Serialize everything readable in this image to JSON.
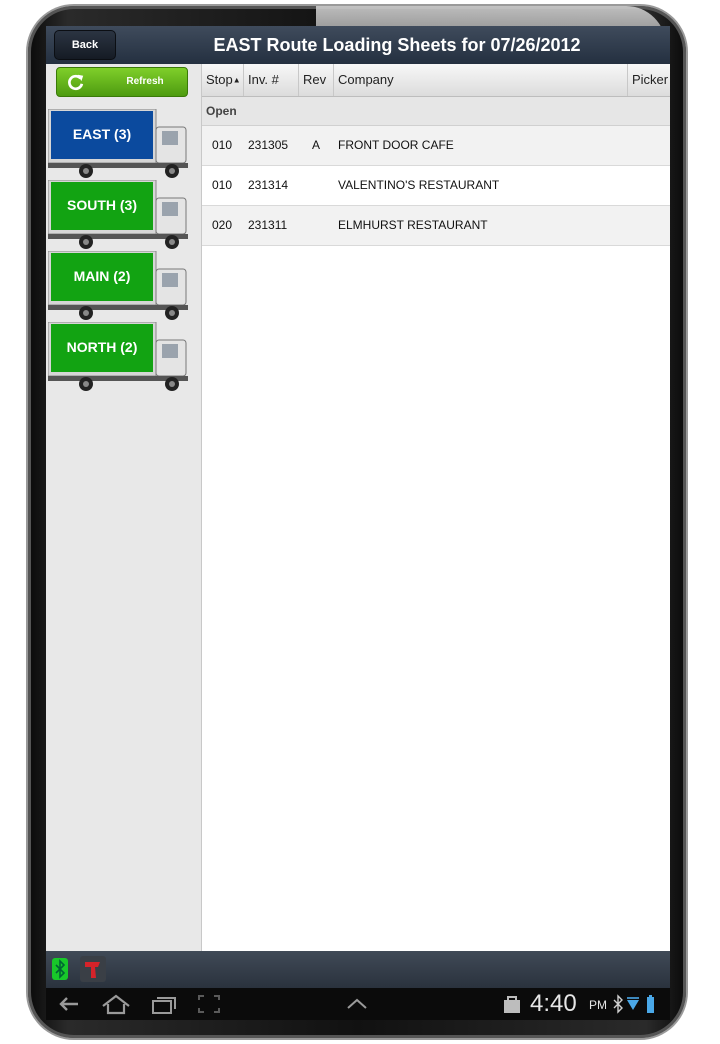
{
  "header": {
    "back_label": "Back",
    "title": "EAST Route Loading Sheets for 07/26/2012"
  },
  "sidebar": {
    "refresh_label": "Refresh",
    "routes": [
      {
        "label": "EAST (3)",
        "color": "#0b4a9e",
        "selected": true
      },
      {
        "label": "SOUTH (3)",
        "color": "#12a312",
        "selected": false
      },
      {
        "label": "MAIN (2)",
        "color": "#12a312",
        "selected": false
      },
      {
        "label": "NORTH (2)",
        "color": "#12a312",
        "selected": false
      }
    ]
  },
  "table": {
    "columns": [
      "Stop",
      "Inv. #",
      "Rev",
      "Company",
      "Picker"
    ],
    "sorted_column": "Stop",
    "group_label": "Open",
    "rows": [
      {
        "stop": "010",
        "inv": "231305",
        "rev": "A",
        "company": "FRONT DOOR CAFE",
        "picker": ""
      },
      {
        "stop": "010",
        "inv": "231314",
        "rev": "",
        "company": "VALENTINO'S RESTAURANT",
        "picker": ""
      },
      {
        "stop": "020",
        "inv": "231311",
        "rev": "",
        "company": "ELMHURST RESTAURANT",
        "picker": ""
      }
    ]
  },
  "status_bar": {
    "time": "4:40",
    "ampm": "PM",
    "icons": [
      "bluetooth-status-icon",
      "scanner-icon",
      "back-nav-icon",
      "home-nav-icon",
      "recent-apps-icon",
      "screenshot-icon",
      "chevron-up-icon",
      "store-icon",
      "bluetooth-icon",
      "wifi-icon",
      "battery-icon"
    ]
  },
  "colors": {
    "selected_route": "#0b4a9e",
    "route": "#12a312",
    "title_bar": "#2e3848"
  }
}
